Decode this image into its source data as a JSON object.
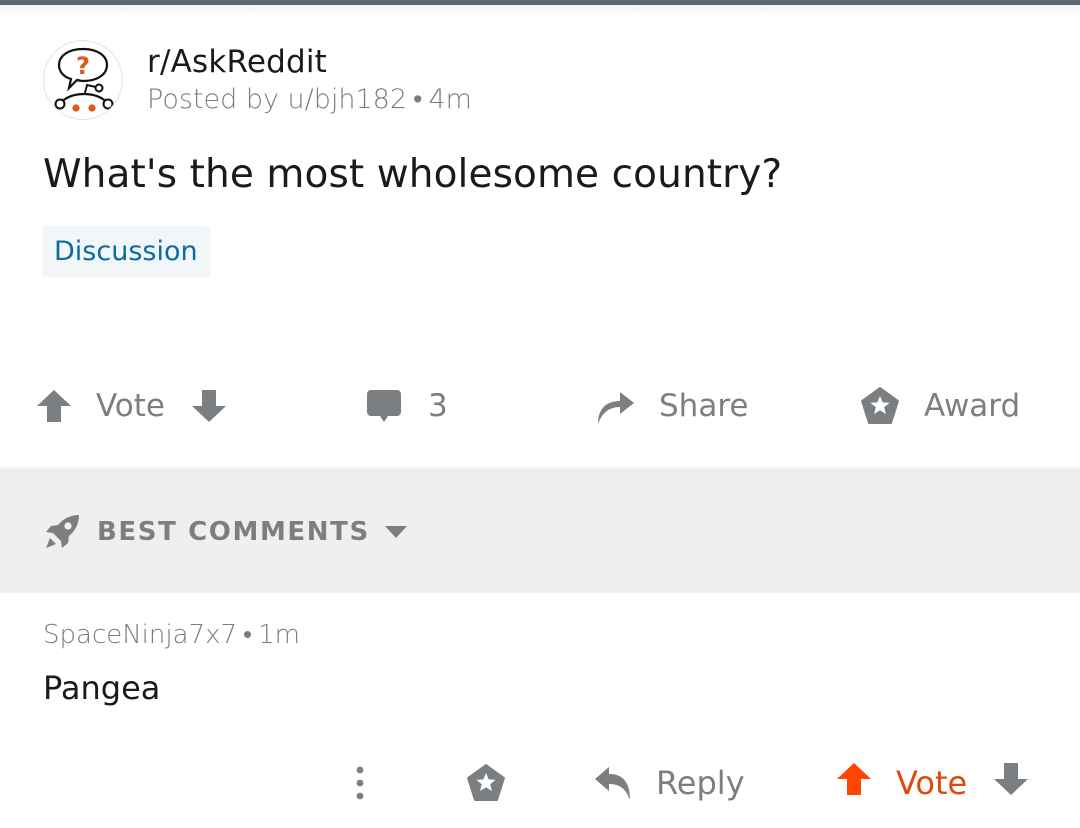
{
  "post": {
    "subreddit": "r/AskReddit",
    "posted_by_prefix": "Posted by",
    "author": "u/bjh182",
    "separator": "•",
    "age": "4m",
    "title": "What's the most wholesome country?",
    "flair": "Discussion"
  },
  "post_actions": {
    "vote_label": "Vote",
    "comment_count": "3",
    "share_label": "Share",
    "award_label": "Award"
  },
  "sort": {
    "label": "BEST COMMENTS"
  },
  "comments": [
    {
      "author": "SpaceNinja7x7",
      "separator": "•",
      "age": "1m",
      "body": "Pangea",
      "reply_label": "Reply",
      "vote_label": "Vote",
      "upvoted": true
    }
  ],
  "colors": {
    "upvote_active": "#ff4500",
    "vote_label_active": "#e0480f",
    "icon_gray": "#7c7f82",
    "flair_text": "#0a6ba3",
    "flair_bg": "#f3f6f8",
    "sort_bar_bg": "#efefef",
    "top_strip": "#5e6670"
  }
}
